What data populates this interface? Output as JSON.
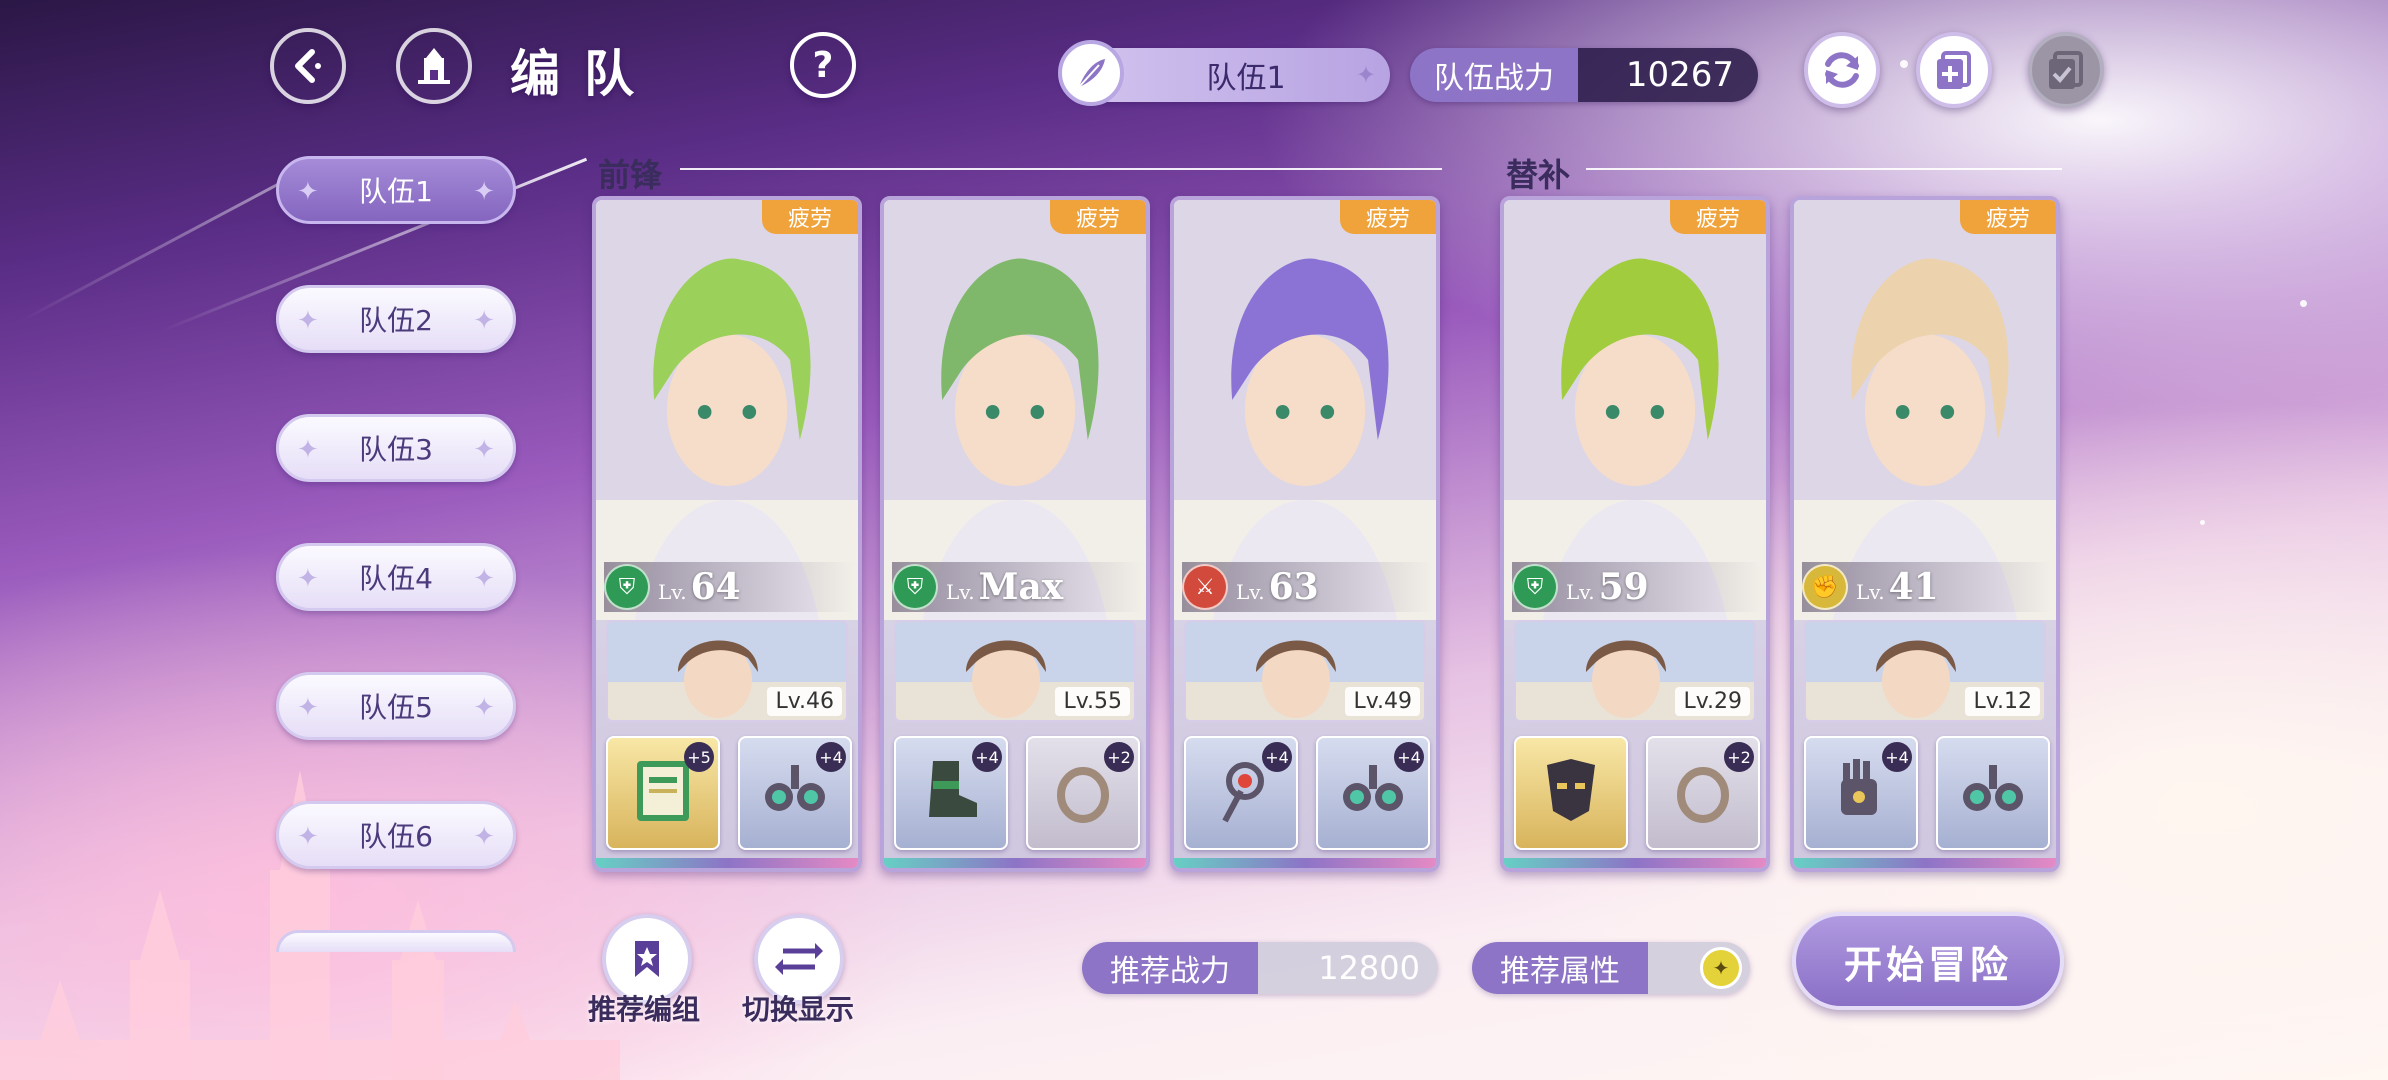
{
  "header": {
    "title": "编队",
    "current_team": "队伍1",
    "power_label": "队伍战力",
    "power_value": "10267"
  },
  "team_tabs": [
    {
      "label": "队伍1",
      "active": true
    },
    {
      "label": "队伍2",
      "active": false
    },
    {
      "label": "队伍3",
      "active": false
    },
    {
      "label": "队伍4",
      "active": false
    },
    {
      "label": "队伍5",
      "active": false
    },
    {
      "label": "队伍6",
      "active": false
    }
  ],
  "sections": {
    "front": "前锋",
    "sub": "替补"
  },
  "cards": [
    {
      "status": "疲劳",
      "lv_prefix": "Lv.",
      "level": "64",
      "attr_color": "#2f9a55",
      "attr_icon": "shield",
      "hair": "#9bd05a",
      "support_lv": "Lv.46",
      "equip": [
        {
          "plus": "+5",
          "style": "gold",
          "icon": "book"
        },
        {
          "plus": "+4",
          "style": "blue",
          "icon": "earrings"
        }
      ]
    },
    {
      "status": "疲劳",
      "lv_prefix": "Lv.",
      "level": "Max",
      "attr_color": "#2f9a55",
      "attr_icon": "shield",
      "hair": "#7fb86a",
      "support_lv": "Lv.55",
      "equip": [
        {
          "plus": "+4",
          "style": "blue",
          "icon": "boot"
        },
        {
          "plus": "+2",
          "style": "gray",
          "icon": "ring"
        }
      ]
    },
    {
      "status": "疲劳",
      "lv_prefix": "Lv.",
      "level": "63",
      "attr_color": "#d24a3c",
      "attr_icon": "sword",
      "hair": "#8b73d6",
      "support_lv": "Lv.49",
      "equip": [
        {
          "plus": "+4",
          "style": "blue",
          "icon": "staff"
        },
        {
          "plus": "+4",
          "style": "blue",
          "icon": "earrings"
        }
      ]
    },
    {
      "status": "疲劳",
      "lv_prefix": "Lv.",
      "level": "59",
      "attr_color": "#2f9a55",
      "attr_icon": "shield",
      "hair": "#a0cc3e",
      "support_lv": "Lv.29",
      "equip": [
        {
          "plus": "",
          "style": "gold",
          "icon": "mask"
        },
        {
          "plus": "+2",
          "style": "gray",
          "icon": "ring"
        }
      ]
    },
    {
      "status": "疲劳",
      "lv_prefix": "Lv.",
      "level": "41",
      "attr_color": "#d7b83a",
      "attr_icon": "fist",
      "hair": "#ecd3ae",
      "support_lv": "Lv.12",
      "equip": [
        {
          "plus": "+4",
          "style": "blue",
          "icon": "gauntlet"
        },
        {
          "plus": "",
          "style": "blue",
          "icon": "earrings"
        }
      ]
    }
  ],
  "bottom": {
    "recommend_team": "推荐编组",
    "switch_display": "切换显示",
    "rec_power_label": "推荐战力",
    "rec_power_value": "12800",
    "rec_attr_label": "推荐属性",
    "rec_attr_icon_color": "#e4d23a",
    "start_label": "开始冒险"
  },
  "icons": [
    "back-icon",
    "castle-icon",
    "help-icon",
    "feather-icon",
    "refresh-icon",
    "add-doc-icon",
    "checklist-icon",
    "bookmark-icon",
    "swap-icon"
  ]
}
